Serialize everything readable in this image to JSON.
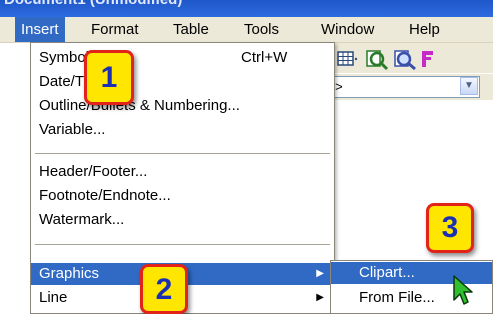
{
  "window": {
    "title": "Document1 (Unmodified)"
  },
  "menubar": {
    "items": [
      {
        "label": "Insert",
        "active": true
      },
      {
        "label": "Format"
      },
      {
        "label": "Table"
      },
      {
        "label": "Tools"
      },
      {
        "label": "Window"
      },
      {
        "label": "Help"
      }
    ]
  },
  "insert_menu": {
    "items": [
      {
        "label": "Symbol...",
        "shortcut": "Ctrl+W"
      },
      {
        "label": "Date/Time..."
      },
      {
        "label": "Outline/Bullets & Numbering..."
      },
      {
        "label": "Variable..."
      },
      {
        "label": "Header/Footer..."
      },
      {
        "label": "Footnote/Endnote..."
      },
      {
        "label": "Watermark..."
      },
      {
        "label": "Graphics",
        "submenu_arrow": "▶"
      },
      {
        "label": "Line",
        "submenu_arrow": "▶"
      }
    ]
  },
  "graphics_submenu": {
    "items": [
      {
        "label": "Clipart..."
      },
      {
        "label": "From File..."
      }
    ]
  },
  "toolbar": {
    "style_combo_value": "None>"
  },
  "callouts": [
    "1",
    "2",
    "3"
  ],
  "colors": {
    "highlight": "#316ac5",
    "badge_fill": "#ffe600",
    "badge_border": "#e2231a",
    "badge_text": "#1a2fb3"
  }
}
